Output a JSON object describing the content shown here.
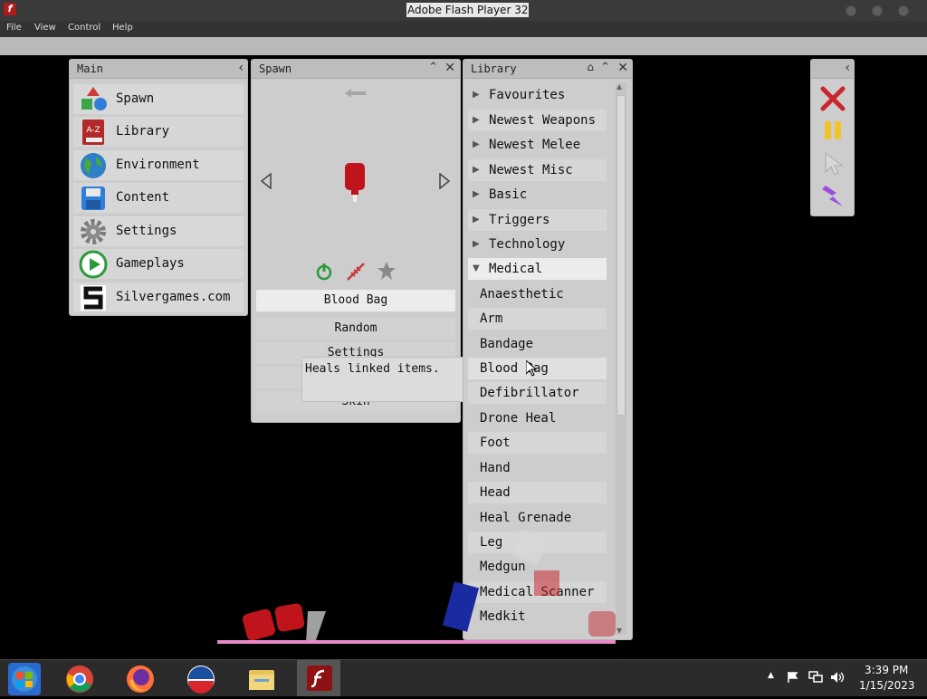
{
  "window": {
    "title": "Adobe Flash Player 32"
  },
  "menu": [
    "File",
    "View",
    "Control",
    "Help"
  ],
  "main_panel": {
    "title": "Main",
    "items": [
      {
        "label": "Spawn",
        "icon": "shapes-icon"
      },
      {
        "label": "Library",
        "icon": "book-a-z-icon"
      },
      {
        "label": "Environment",
        "icon": "globe-icon"
      },
      {
        "label": "Content",
        "icon": "floppy-disk-icon"
      },
      {
        "label": "Settings",
        "icon": "gear-icon"
      },
      {
        "label": "Gameplays",
        "icon": "play-icon"
      },
      {
        "label": "Silvergames.com",
        "icon": "silvergames-logo-icon"
      }
    ]
  },
  "spawn_panel": {
    "title": "Spawn",
    "selected_item": "Blood Bag",
    "buttons": [
      "Random",
      "Settings",
      "Skin"
    ]
  },
  "tooltip": {
    "text": "Heals linked items."
  },
  "library_panel": {
    "title": "Library",
    "categories": [
      "Favourites",
      "Newest Weapons",
      "Newest Melee",
      "Newest Misc",
      "Basic",
      "Triggers",
      "Technology"
    ],
    "expanded_category": "Medical",
    "items": [
      "Anaesthetic",
      "Arm",
      "Bandage",
      "Blood Bag",
      "Defibrillator",
      "Drone Heal",
      "Foot",
      "Hand",
      "Head",
      "Heal Grenade",
      "Leg",
      "Medgun",
      "Medical Scanner",
      "Medkit"
    ]
  },
  "taskbar": {
    "time": "3:39 PM",
    "date": "1/15/2023"
  },
  "colors": {
    "accent_red": "#b01c1c",
    "panel_bg": "#cdcdcd",
    "taskbar_bg": "#2b2b2b"
  }
}
